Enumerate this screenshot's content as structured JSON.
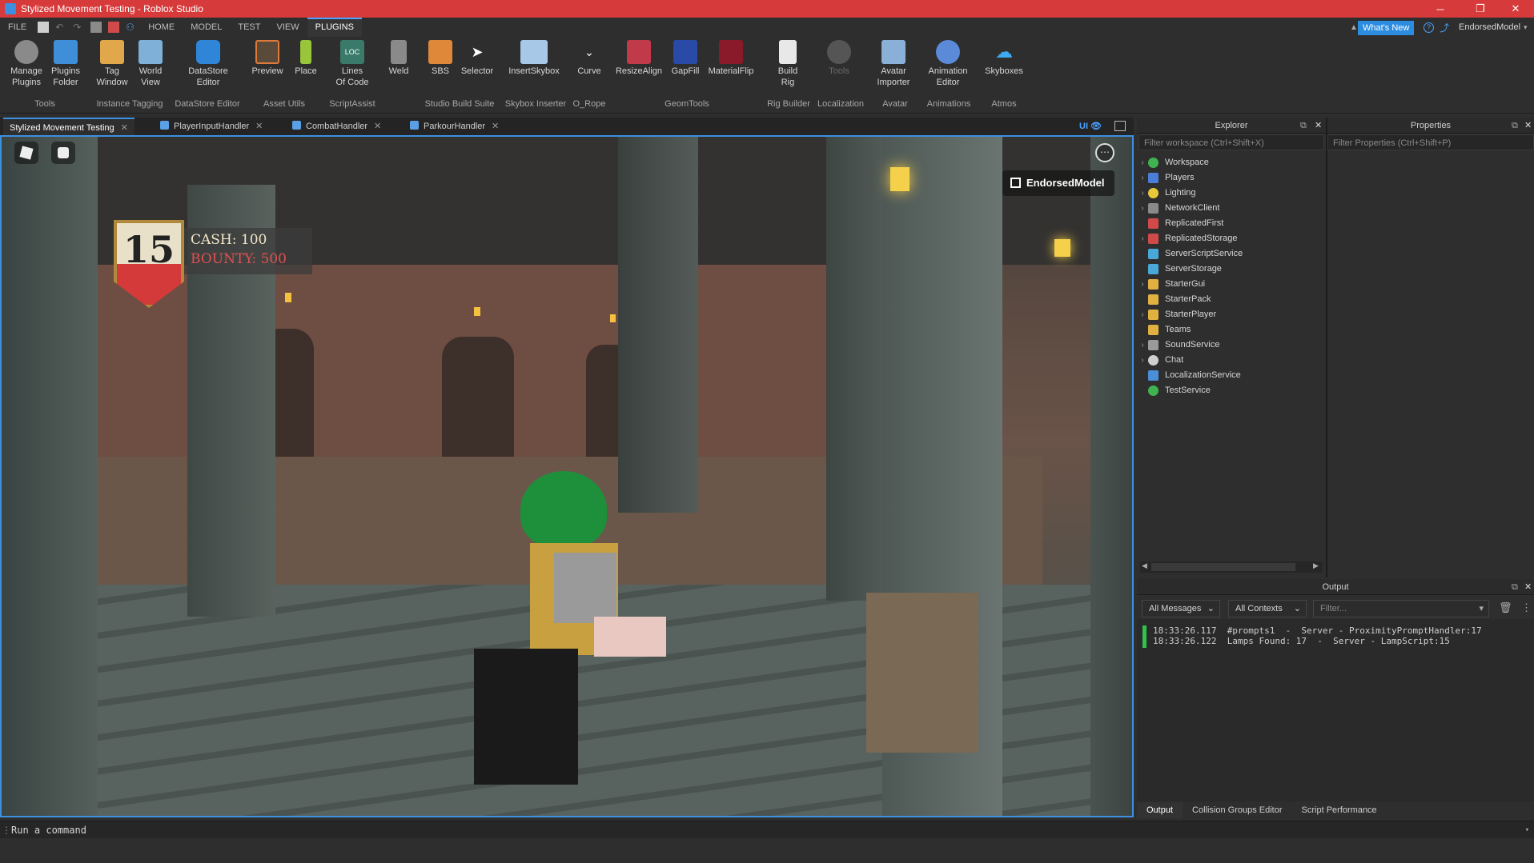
{
  "window": {
    "title": "Stylized Movement Testing - Roblox Studio"
  },
  "menubar": {
    "file": "FILE",
    "tabs": [
      "HOME",
      "MODEL",
      "TEST",
      "VIEW",
      "PLUGINS"
    ],
    "active_tab": "PLUGINS",
    "whats_new": "What's New",
    "user": "EndorsedModel"
  },
  "ribbon": {
    "buttons": [
      {
        "label": "Manage\nPlugins",
        "icon": "gear-icon"
      },
      {
        "label": "Plugins\nFolder",
        "icon": "folder-icon"
      },
      {
        "label": "Tag\nWindow",
        "icon": "tag-icon"
      },
      {
        "label": "World\nView",
        "icon": "grid-icon"
      },
      {
        "label": "DataStore\nEditor",
        "icon": "database-icon"
      },
      {
        "label": "Preview",
        "icon": "preview-icon"
      },
      {
        "label": "Place",
        "icon": "place-icon"
      },
      {
        "label": "Lines\nOf Code",
        "icon": "loc-icon"
      },
      {
        "label": "Weld",
        "icon": "weld-icon"
      },
      {
        "label": "SBS",
        "icon": "sbs-icon"
      },
      {
        "label": "Selector",
        "icon": "cursor-icon"
      },
      {
        "label": "InsertSkybox",
        "icon": "skybox-icon"
      },
      {
        "label": "Curve",
        "icon": "curve-icon"
      },
      {
        "label": "ResizeAlign",
        "icon": "resize-icon"
      },
      {
        "label": "GapFill",
        "icon": "gapfill-icon"
      },
      {
        "label": "MaterialFlip",
        "icon": "materialflip-icon"
      },
      {
        "label": "Build\nRig",
        "icon": "rig-icon"
      },
      {
        "label": "Tools",
        "icon": "globe-icon"
      },
      {
        "label": "Avatar\nImporter",
        "icon": "avatar-icon"
      },
      {
        "label": "Animation\nEditor",
        "icon": "animation-icon"
      },
      {
        "label": "Skyboxes",
        "icon": "cloud-icon"
      }
    ],
    "groups": [
      "Tools",
      "Instance Tagging",
      "DataStore Editor",
      "Asset Utils",
      "ScriptAssist",
      "Studio Build Suite",
      "Skybox Inserter",
      "O_Rope",
      "GeomTools",
      "Rig Builder",
      "Localization",
      "Avatar",
      "Animations",
      "Atmos"
    ]
  },
  "tabs": [
    {
      "label": "Stylized Movement Testing",
      "active": true
    },
    {
      "label": "PlayerInputHandler",
      "active": false
    },
    {
      "label": "CombatHandler",
      "active": false
    },
    {
      "label": "ParkourHandler",
      "active": false
    }
  ],
  "viewport": {
    "ui_toggle": "UI",
    "hud": {
      "level": "15",
      "cash": "CASH: 100",
      "bounty": "BOUNTY: 500"
    },
    "user_badge": "EndorsedModel"
  },
  "explorer": {
    "title": "Explorer",
    "filter_placeholder": "Filter workspace (Ctrl+Shift+X)",
    "items": [
      {
        "label": "Workspace",
        "expandable": true,
        "color": "#3fb34f"
      },
      {
        "label": "Players",
        "expandable": true,
        "color": "#4a7ed8"
      },
      {
        "label": "Lighting",
        "expandable": true,
        "color": "#e8c83a"
      },
      {
        "label": "NetworkClient",
        "expandable": true,
        "color": "#8a8a8a"
      },
      {
        "label": "ReplicatedFirst",
        "expandable": false,
        "color": "#d04a4a"
      },
      {
        "label": "ReplicatedStorage",
        "expandable": true,
        "color": "#d04a4a"
      },
      {
        "label": "ServerScriptService",
        "expandable": false,
        "color": "#4aa8d8"
      },
      {
        "label": "ServerStorage",
        "expandable": false,
        "color": "#4aa8d8"
      },
      {
        "label": "StarterGui",
        "expandable": true,
        "color": "#e0b040"
      },
      {
        "label": "StarterPack",
        "expandable": false,
        "color": "#e0b040"
      },
      {
        "label": "StarterPlayer",
        "expandable": true,
        "color": "#e0b040"
      },
      {
        "label": "Teams",
        "expandable": false,
        "color": "#e0b040"
      },
      {
        "label": "SoundService",
        "expandable": true,
        "color": "#9a9a9a"
      },
      {
        "label": "Chat",
        "expandable": true,
        "color": "#cfcfcf"
      },
      {
        "label": "LocalizationService",
        "expandable": false,
        "color": "#4a8ed8"
      },
      {
        "label": "TestService",
        "expandable": false,
        "color": "#3fb34f"
      }
    ]
  },
  "properties": {
    "title": "Properties",
    "filter_placeholder": "Filter Properties (Ctrl+Shift+P)"
  },
  "output": {
    "title": "Output",
    "messages_filter": "All Messages",
    "contexts_filter": "All Contexts",
    "filter_placeholder": "Filter...",
    "lines": [
      "18:33:26.117  #prompts1  -  Server - ProximityPromptHandler:17",
      "18:33:26.122  Lamps Found: 17  -  Server - LampScript:15"
    ],
    "tabs": [
      "Output",
      "Collision Groups Editor",
      "Script Performance"
    ]
  },
  "command_bar": {
    "placeholder": "Run a command"
  }
}
